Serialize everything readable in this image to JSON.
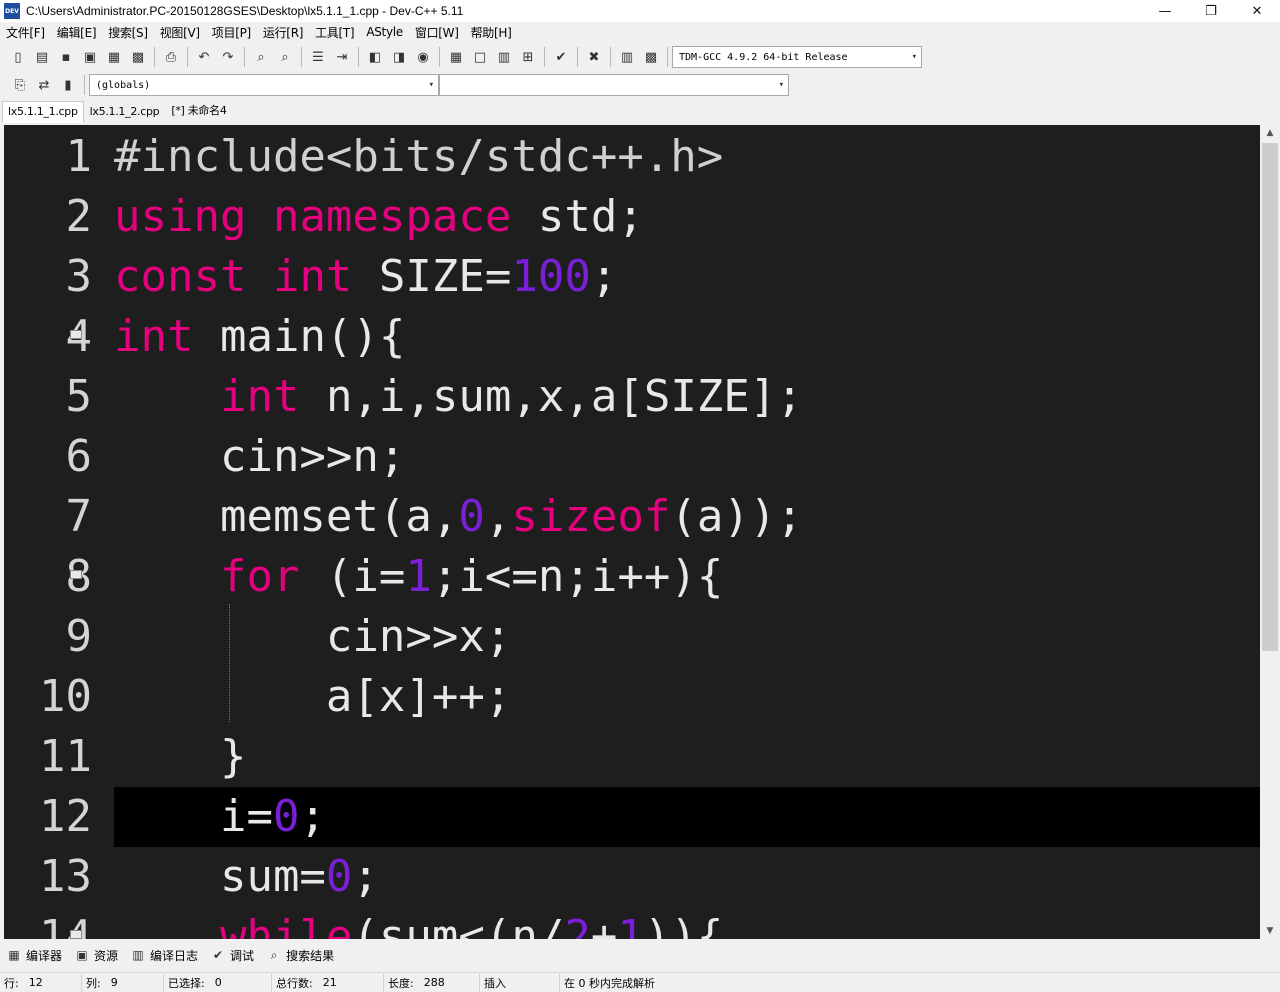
{
  "window": {
    "title": "C:\\Users\\Administrator.PC-20150128GSES\\Desktop\\lx5.1.1_1.cpp - Dev-C++ 5.11",
    "app_icon_text": "DEV",
    "minimize": "—",
    "maximize": "❐",
    "close": "✕"
  },
  "menu": [
    "文件[F]",
    "编辑[E]",
    "搜索[S]",
    "视图[V]",
    "项目[P]",
    "运行[R]",
    "工具[T]",
    "AStyle",
    "窗口[W]",
    "帮助[H]"
  ],
  "toolbar": {
    "compiler_select": "TDM-GCC 4.9.2 64-bit Release",
    "scope_select": "(globals)",
    "function_select": ""
  },
  "tabs": [
    "lx5.1.1_1.cpp",
    "lx5.1.1_2.cpp",
    "[*] 未命名4"
  ],
  "editor": {
    "line_numbers": [
      "1",
      "2",
      "3",
      "4",
      "5",
      "6",
      "7",
      "8",
      "9",
      "10",
      "11",
      "12",
      "13",
      "14"
    ],
    "current_line": 12
  },
  "bottom_tabs": [
    "编译器",
    "资源",
    "编译日志",
    "调试",
    "搜索结果"
  ],
  "status": {
    "row_label": "行:",
    "row_value": "12",
    "col_label": "列:",
    "col_value": "9",
    "selected_label": "已选择:",
    "selected_value": "0",
    "total_lines_label": "总行数:",
    "total_lines_value": "21",
    "length_label": "长度:",
    "length_value": "288",
    "insert_mode": "插入",
    "parse_message": "在 0 秒内完成解析"
  },
  "colors": {
    "keyword": "#e5007f",
    "number": "#7a1fd6",
    "editor_bg": "#1e1e1e",
    "current_line_bg": "#000000"
  }
}
